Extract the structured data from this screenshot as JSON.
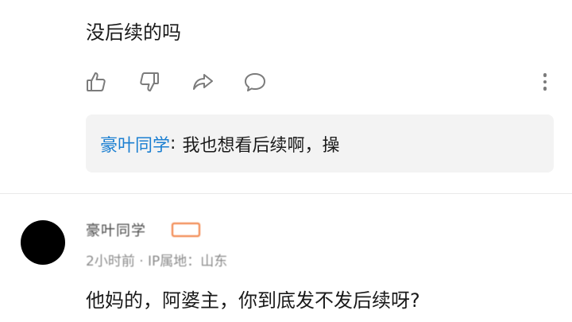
{
  "top_comment": {
    "text": "没后续的吗",
    "actions": [
      "thumbs-up-icon",
      "thumbs-down-icon",
      "share-icon",
      "reply-bubble-icon",
      "more-vertical-icon"
    ],
    "reply": {
      "name": "豪叶同学",
      "colon": ":",
      "text": "我也想看后续啊，操"
    }
  },
  "second_comment": {
    "username": "豪叶同学",
    "meta": "2小时前 · IP属地：山东",
    "text": "他妈的，阿婆主，你到底发不发后续呀?"
  },
  "colors": {
    "link_blue": "#1b7fd1",
    "icon_gray": "#7b7b7b",
    "reply_bg": "#f3f3f3",
    "badge_orange": "#f07a3a"
  }
}
